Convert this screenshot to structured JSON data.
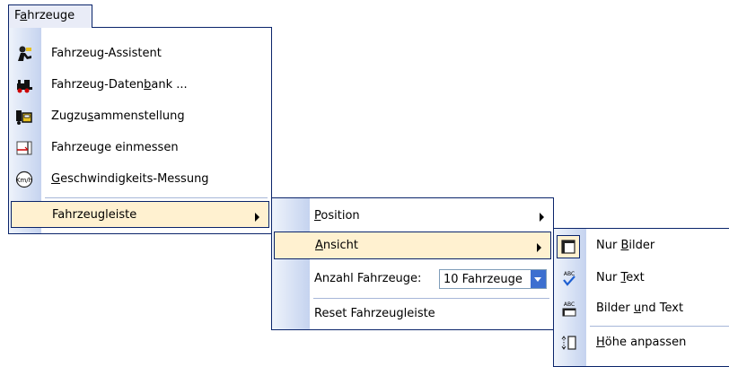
{
  "menubar": {
    "item_label_pre": "F",
    "item_label_ul": "a",
    "item_label_post": "hrzeuge"
  },
  "menu1": {
    "items": [
      {
        "label_pre": "Fahrzeug-Assistent",
        "icon": "assistant-icon"
      },
      {
        "label_pre": "Fahrzeug-Daten",
        "label_ul": "b",
        "label_post": "ank ...",
        "icon": "locomotive-icon"
      },
      {
        "label_pre": "Zugzu",
        "label_ul": "s",
        "label_post": "ammenstellung",
        "icon": "train-composition-icon"
      },
      {
        "label_pre": "Fahrzeuge einmessen",
        "icon": "measure-icon"
      },
      {
        "label_ul": "G",
        "label_post": "eschwindigkeits-Messung",
        "icon": "kmh-icon"
      },
      {
        "label_pre": "Fahrzeugleiste"
      }
    ]
  },
  "menu2": {
    "position_ul": "P",
    "position_post": "osition",
    "ansicht_ul": "A",
    "ansicht_post": "nsicht",
    "anzahl_pre": "Anzahl Fahrzeuge:",
    "anzahl_value": "10 Fahrzeuge",
    "reset_label": "Reset Fahrzeugleiste"
  },
  "menu3": {
    "nur_bilder_pre": "Nur ",
    "nur_bilder_ul": "B",
    "nur_bilder_post": "ilder",
    "nur_text_pre": "Nur ",
    "nur_text_ul": "T",
    "nur_text_post": "ext",
    "bilder_text_pre": "Bilder ",
    "bilder_text_ul": "u",
    "bilder_text_post": "nd Text",
    "hoehe_ul": "H",
    "hoehe_post": "öhe anpassen",
    "abc": "ABC"
  },
  "colors": {
    "border": "#0a246a",
    "highlight": "#fff1d0",
    "menubar_bg": "#e9ecf7"
  }
}
